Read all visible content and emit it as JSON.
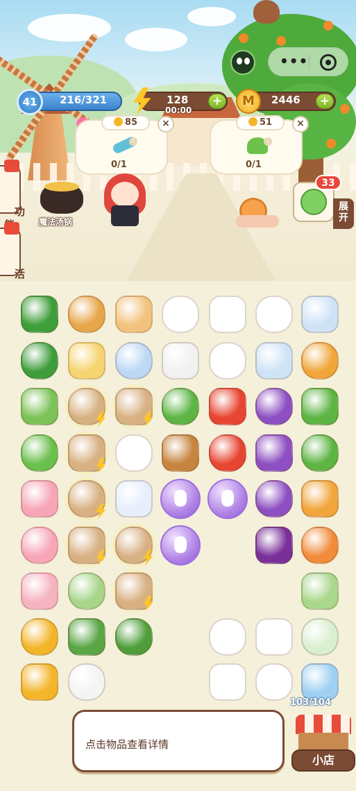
{
  "hud": {
    "level": "41",
    "exp": "216/321",
    "energy": "128",
    "energy_timer": "00:00",
    "coins": "2446",
    "plus": "+"
  },
  "orders": [
    {
      "price": "85",
      "count": "0/1",
      "item_icon": "toothbrush-icon"
    },
    {
      "price": "51",
      "count": "0/1",
      "item_icon": "plant-icon"
    }
  ],
  "close_symbol": "×",
  "info_symbol": "i",
  "side_tabs": [
    {
      "label": "功\n能"
    },
    {
      "label": "活\n动"
    }
  ],
  "scene": {
    "pot_label": "魔法汤锅"
  },
  "expand": {
    "badge": "33",
    "label": "展\n开"
  },
  "board": {
    "capacity": "103/104",
    "hint": "点击物品查看详情"
  },
  "shop": {
    "label": "小店"
  },
  "colors": {
    "brown": "#7b4b34",
    "board_bg": "#f4f0da",
    "coin": "#f3b52a",
    "energy": "#ffc624"
  },
  "items": [
    [
      "watermelon-slice-icon",
      "teddy-bear-icon",
      "doll-icon",
      "unicorn-icon",
      "bunny-gift-icon",
      "bunny-doll-icon",
      "face-mask-icon"
    ],
    [
      "watermelon-icon",
      "honey-jar-icon",
      "sheep-plush-icon",
      "snowman-icon",
      "bunny-plush-icon",
      "mask-pack-icon",
      "flower-bouquet-icon"
    ],
    [
      "lettuce-basket-icon",
      "locked-crate-icon",
      "locked-barrel-icon",
      "cucumber-icon",
      "tomato-crate-icon",
      "grape-basket-icon",
      "cucumber-pair-icon"
    ],
    [
      "salad-bowl-icon",
      "locked-bag-icon",
      "goose-icon",
      "acorn-icon",
      "tomato-pair-icon",
      "grapes-icon",
      "cucumber-slice-icon"
    ],
    [
      "pink-monster-icon",
      "locked-chest-icon",
      "butterfly-icon",
      "purple-bubble-icon",
      "purple-bubble-icon",
      "grape-small-icon",
      "flower-vase-icon"
    ],
    [
      "pink-sheep-icon",
      "locked-flowerbox-icon",
      "locked-veggie-basket-icon",
      "purple-bubble-icon",
      "",
      "plum-icon",
      "rose-icon"
    ],
    [
      "bouquet-icon",
      "pea-pod-icon",
      "locked-backpack-icon",
      "",
      "",
      "",
      "cabbage-icon"
    ],
    [
      "gold-coin-pile-icon",
      "spinach-icon",
      "chard-icon",
      "",
      "bunny-small-icon",
      "bunny-sleeping-icon",
      "strawberry-icon"
    ],
    [
      "gold-coin-stack-icon",
      "sugar-cube-icon",
      "",
      "",
      "bunny-sitting-icon",
      "bunny-carrot-icon",
      "storage-box-icon"
    ]
  ]
}
